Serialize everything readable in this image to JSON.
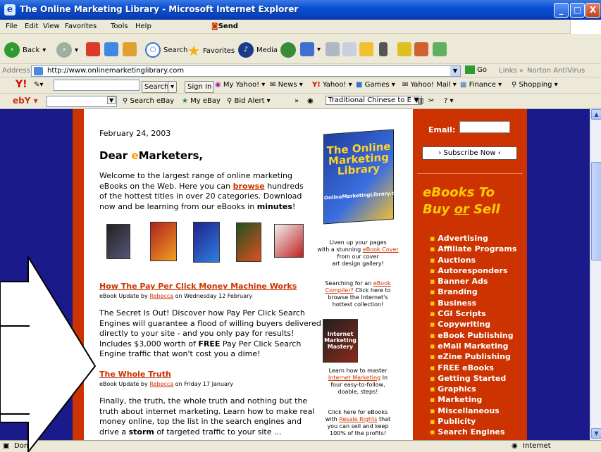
{
  "window": {
    "title": "The Online Marketing Library - Microsoft Internet Explorer",
    "buttons": [
      "_",
      "□",
      "X"
    ]
  },
  "menu": [
    "File",
    "Edit",
    "View",
    "Favorites",
    "Tools",
    "Help"
  ],
  "menu_send": "Send",
  "toolbar": {
    "back": "Back",
    "search": "Search",
    "favorites": "Favorites",
    "media": "Media"
  },
  "address": {
    "label": "Address",
    "url": "http://www.onlinemarketinglibrary.com",
    "go": "Go",
    "links": "Links",
    "norton": "Norton AntiVirus"
  },
  "yahoo_bar": {
    "search_btn": "Search",
    "sign_in": "Sign In",
    "items": [
      "My Yahoo!",
      "News",
      "Yahoo!",
      "Games",
      "Yahoo! Mail",
      "Finance",
      "Shopping"
    ]
  },
  "ebay_bar": {
    "search": "Search eBay",
    "my_ebay": "My eBay",
    "bid_alert": "Bid Alert",
    "translate": "Traditional Chinese to E"
  },
  "page": {
    "date": "February 24, 2003",
    "greeting_pre": "Dear ",
    "greeting_e": "e",
    "greeting_post": "Marketers,",
    "welcome_1": "Welcome to the largest range of online marketing",
    "welcome_2": "eBooks on the Web. Here you can",
    "browse": "browse",
    "welcome_3": "hundreds",
    "welcome_4": "of the hottest titles in over 20 categories. Download",
    "welcome_5": "now and be learning from our eBooks in",
    "minutes": "minutes",
    "welcome_6": "!",
    "article1_title": "How The Pay Per Click Money Machine Works",
    "article1_meta_pre": "eBook Update by",
    "article1_author": "Rebecca",
    "article1_meta_post": "on Wednesday 12 February",
    "article1_body_1": "The Secret Is Out! Discover how Pay Per Click Search",
    "article1_body_2": "Engines will guarantee a flood of willing buyers delivered",
    "article1_body_3": "directly to your site - and you only pay for results!",
    "article1_body_4a": "Includes $3,000 worth of",
    "article1_body_free": "FREE",
    "article1_body_4b": "Pay Per Click Search",
    "article1_body_5": "Engine traffic that won't cost you a dime!",
    "article2_title": "The Whole Truth",
    "article2_meta_pre": "eBook Update by",
    "article2_author": "Rebecca",
    "article2_meta_post": "on Friday 17 January",
    "article2_body_1": "Finally, the truth, the whole truth and nothing but the",
    "article2_body_2": "truth about internet marketing. Learn how to make real",
    "article2_body_3": "money online, top the list in the search engines and",
    "article2_body_4a": "drive a",
    "article2_body_storm": "storm",
    "article2_body_4b": "of targeted traffic to your site ...",
    "cover_title": "The Online Marketing Library",
    "cover_url": "OnlineMarketingLibrary.com",
    "side1_a": "Liven up your pages",
    "side1_b": "with a stunning",
    "side1_link": "eBook Cover",
    "side1_c": "from our cover",
    "side1_d": "art design gallery!",
    "side2_a": "Searching for an",
    "side2_link": "eBook Compiler?",
    "side2_b": "Click here to",
    "side2_c": "browse the Internet's",
    "side2_d": "hottest collection!",
    "side3_a": "Learn how to master",
    "side3_link": "Internet Marketing",
    "side3_b": "In",
    "side3_c": "four easy-to-follow,",
    "side3_d": "doable, steps!",
    "side4_a": "Click here for eBooks",
    "side4_b": "with",
    "side4_link": "Resale Rights",
    "side4_c": "that",
    "side4_d": "you can sell and keep",
    "side4_e": "100% of the profits!",
    "book_imm": "Internet Marketing Mastery"
  },
  "right": {
    "email_label": "Email:",
    "subscribe": "› Subscribe Now ‹",
    "ebooks_line1_e": "e",
    "ebooks_line1": "Books To",
    "ebooks_line2a": "Buy",
    "ebooks_or": "or",
    "ebooks_line2b": "Sell",
    "categories": [
      "Advertising",
      "Affiliate Programs",
      "Auctions",
      "Autoresponders",
      "Banner Ads",
      "Branding",
      "Business",
      "CGI Scripts",
      "Copywriting",
      "eBook Publishing",
      "eMail Marketing",
      "eZine Publishing",
      "FREE eBooks",
      "Getting Started",
      "Graphics",
      "Marketing",
      "Miscellaneous",
      "Publicity",
      "Search Engines"
    ]
  },
  "status": {
    "left": "Done",
    "zone": "Internet"
  },
  "colors": {
    "accent_red": "#cc3300",
    "navy": "#1a1a8a",
    "gold": "#ffcc00",
    "xp_blue": "#0a46c4"
  }
}
